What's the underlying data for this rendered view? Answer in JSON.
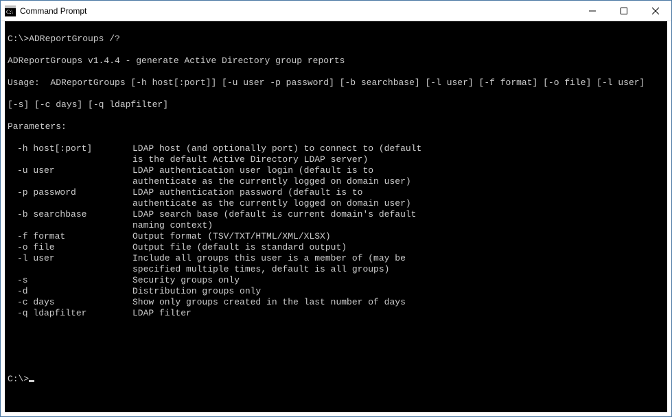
{
  "window": {
    "title": "Command Prompt"
  },
  "terminal": {
    "prompt1": "C:\\>ADReportGroups /?",
    "version_line": "ADReportGroups v1.4.4 - generate Active Directory group reports",
    "usage_line1": "Usage:  ADReportGroups [-h host[:port]] [-u user -p password] [-b searchbase] [-l user] [-f format] [-o file] [-l user]",
    "usage_line2": "[-s] [-c days] [-q ldapfilter]",
    "params_header": "Parameters:",
    "params": [
      {
        "flag": "-h host[:port]",
        "desc": "LDAP host (and optionally port) to connect to (default",
        "cont": "is the default Active Directory LDAP server)"
      },
      {
        "flag": "-u user",
        "desc": "LDAP authentication user login (default is to",
        "cont": "authenticate as the currently logged on domain user)"
      },
      {
        "flag": "-p password",
        "desc": "LDAP authentication password (default is to",
        "cont": "authenticate as the currently logged on domain user)"
      },
      {
        "flag": "-b searchbase",
        "desc": "LDAP search base (default is current domain's default",
        "cont": "naming context)"
      },
      {
        "flag": "-f format",
        "desc": "Output format (TSV/TXT/HTML/XML/XLSX)"
      },
      {
        "flag": "-o file",
        "desc": "Output file (default is standard output)"
      },
      {
        "flag": "-l user",
        "desc": "Include all groups this user is a member of (may be",
        "cont": "specified multiple times, default is all groups)"
      },
      {
        "flag": "-s",
        "desc": "Security groups only"
      },
      {
        "flag": "-d",
        "desc": "Distribution groups only"
      },
      {
        "flag": "-c days",
        "desc": "Show only groups created in the last number of days"
      },
      {
        "flag": "-q ldapfilter",
        "desc": "LDAP filter"
      }
    ],
    "prompt2": "C:\\>"
  }
}
